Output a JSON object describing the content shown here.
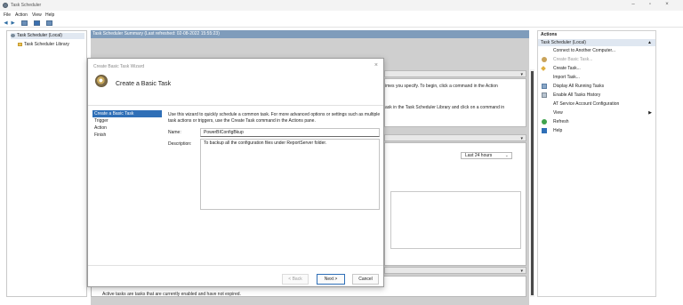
{
  "window": {
    "title": "Task Scheduler"
  },
  "window_controls": {
    "minimize": "–",
    "maximize": "▫",
    "close": "×"
  },
  "menu": [
    "File",
    "Action",
    "View",
    "Help"
  ],
  "tree": {
    "root": "Task Scheduler (Local)",
    "child": "Task Scheduler Library"
  },
  "summary": {
    "header": "Task Scheduler Summary (Last refreshed: 02-08-2022 15:55:23)",
    "text_1": "imes you specify. To begin, click a command in the Action",
    "text_2": "ask in the Task Scheduler Library and click on a command in",
    "period": "Last 24 hours",
    "active_tasks_text": "Active tasks are tasks that are currently enabled and have not expired."
  },
  "dialog": {
    "title": "Create Basic Task Wizard",
    "heading": "Create a Basic Task",
    "close": "×",
    "steps": [
      "Create a Basic Task",
      "Trigger",
      "Action",
      "Finish"
    ],
    "intro": "Use this wizard to quickly schedule a common task.  For more advanced options or settings such as multiple task actions or triggers, use the Create Task command in the Actions pane.",
    "name_label": "Name:",
    "name_value": "PowerBIConfigBkup",
    "description_label": "Description:",
    "description_value": "To backup all the configuration files under ReportServer folder.",
    "back_label": "< Back",
    "next_label": "Next >",
    "cancel_label": "Cancel"
  },
  "actions": {
    "header": "Actions",
    "section": "Task Scheduler (Local)",
    "items": [
      {
        "label": "Connect to Another Computer...",
        "icon": "none"
      },
      {
        "label": "Create Basic Task...",
        "icon": "create-basic-task-icon"
      },
      {
        "label": "Create Task...",
        "icon": "create-task-icon"
      },
      {
        "label": "Import Task...",
        "icon": "none"
      },
      {
        "label": "Display All Running Tasks",
        "icon": "running-tasks-icon"
      },
      {
        "label": "Enable All Tasks History",
        "icon": "history-icon"
      },
      {
        "label": "AT Service Account Configuration",
        "icon": "none"
      },
      {
        "label": "View",
        "icon": "none"
      },
      {
        "label": "Refresh",
        "icon": "refresh-icon"
      },
      {
        "label": "Help",
        "icon": "help-icon"
      }
    ]
  },
  "colors": {
    "accent": "#2f6fb7",
    "header_bar": "#7f9cbb",
    "selection": "#dfe7f1"
  }
}
